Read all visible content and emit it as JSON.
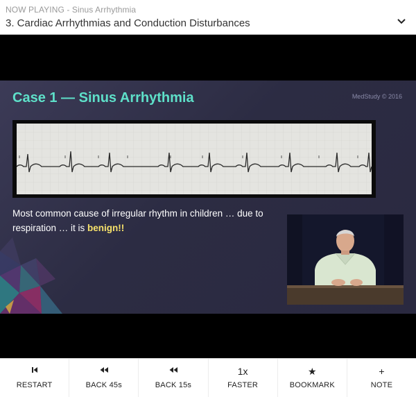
{
  "header": {
    "now_playing_label": "NOW PLAYING",
    "now_playing_separator": " - ",
    "now_playing_topic": "Sinus Arrhythmia",
    "lecture_title": "3. Cardiac Arrhythmias and Conduction Disturbances",
    "chevron_icon": "chevron-down-icon"
  },
  "slide": {
    "title": "Case 1 — Sinus Arrhythmia",
    "brand": "MedStudy © 2016",
    "text_part1": "Most common cause of irregular rhythm in children … due to respiration … it is ",
    "text_highlight": "benign!!",
    "title_color": "#5ee0c9",
    "highlight_color": "#f7e26b"
  },
  "controls": [
    {
      "icon": "skip-start-icon",
      "glyph": "⏮",
      "label": "RESTART"
    },
    {
      "icon": "rewind-icon",
      "glyph": "◀◀",
      "label": "BACK 45s"
    },
    {
      "icon": "rewind-icon",
      "glyph": "◀◀",
      "label": "BACK 15s"
    },
    {
      "icon": "speed-text",
      "glyph": "1x",
      "label": "FASTER"
    },
    {
      "icon": "star-icon",
      "glyph": "★",
      "label": "BOOKMARK"
    },
    {
      "icon": "plus-icon",
      "glyph": "+",
      "label": "NOTE"
    }
  ]
}
